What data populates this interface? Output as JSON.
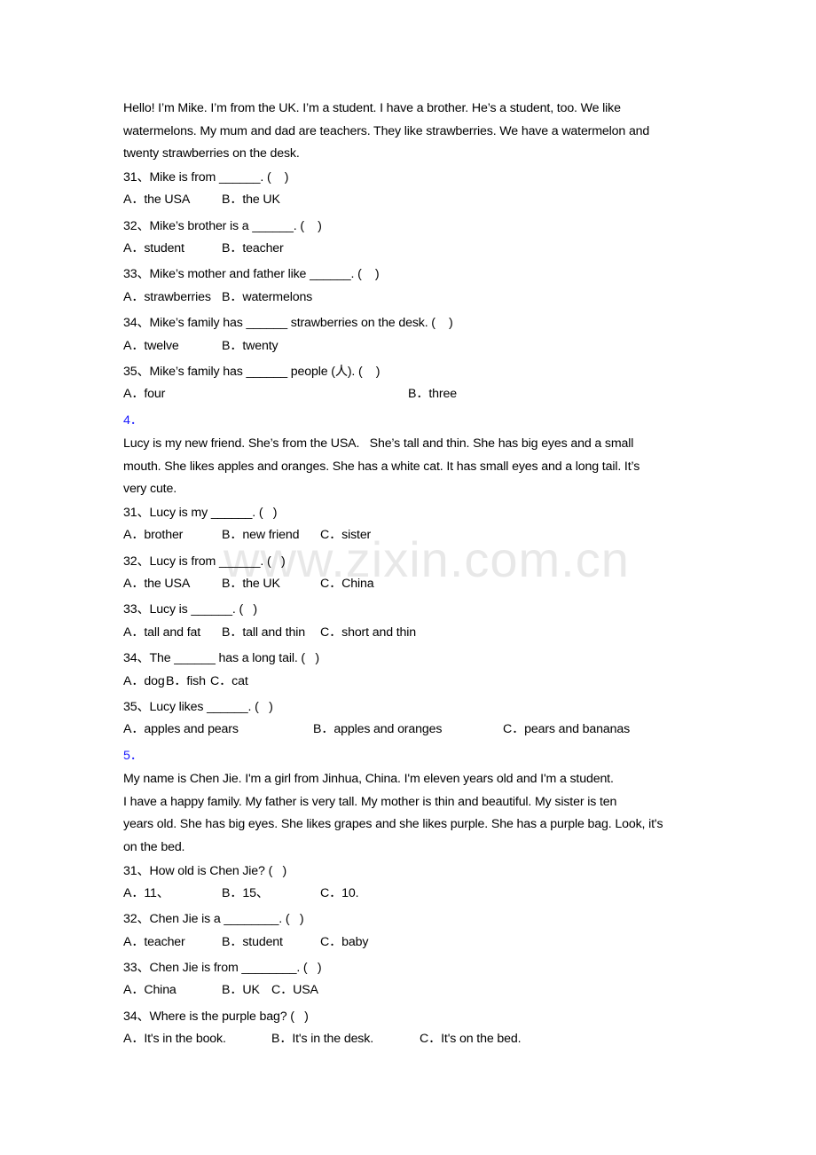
{
  "watermark": "www.zixin.com.cn",
  "sections": [
    {
      "number": "",
      "passage": [
        "Hello! I’m Mike. I’m from the UK. I’m a student. I have a brother. He’s a student, too. We like",
        "watermelons. My mum and dad are teachers. They like strawberries. We have a watermelon and",
        "twenty strawberries on the desk."
      ],
      "questions": [
        {
          "q": "31、Mike is from ______. (    )",
          "options": [
            "A．the USA",
            "B．the UK"
          ]
        },
        {
          "q": "32、Mike’s brother is a ______. (    )",
          "options": [
            "A．student",
            "B．teacher"
          ]
        },
        {
          "q": "33、Mike’s mother and father like ______. (    )",
          "options": [
            "A．strawberries",
            "B．watermelons"
          ]
        },
        {
          "q": "34、Mike’s family has ______ strawberries on the desk. (    )",
          "options": [
            "A．twelve",
            "B．twenty"
          ]
        },
        {
          "q": "35、Mike’s family has ______ people (人). (    )",
          "options": [
            "A．four",
            "B．three"
          ]
        }
      ]
    },
    {
      "number": "4．",
      "passage": [
        "Lucy is my new friend. She’s from the USA.   She’s tall and thin. She has big eyes and a small",
        "mouth. She likes apples and oranges. She has a white cat. It has small eyes and a long tail. It’s",
        "very cute."
      ],
      "questions": [
        {
          "q": "31、Lucy is my ______. (   )",
          "options": [
            "A．brother",
            "B．new friend",
            "C．sister"
          ]
        },
        {
          "q": "32、Lucy is from ______. (   )",
          "options": [
            "A．the USA",
            "B．the UK",
            "C．China"
          ]
        },
        {
          "q": "33、Lucy is ______. (   )",
          "options": [
            "A．tall and fat",
            "B．tall and thin",
            "C．short and thin"
          ]
        },
        {
          "q": "34、The ______ has a long tail. (   )",
          "options": [
            "A．dog",
            "B．fish",
            "C．cat"
          ]
        },
        {
          "q": "35、Lucy likes ______. (   )",
          "options": [
            "A．apples and pears",
            "B．apples and oranges",
            "C．pears and bananas"
          ]
        }
      ]
    },
    {
      "number": "5．",
      "passage": [
        "My name is Chen Jie. I'm a girl from Jinhua, China. I'm eleven years old and I'm a student.",
        "I have a happy family. My father is very tall. My mother is thin and beautiful. My sister is ten",
        "years old. She has big eyes. She likes grapes and she likes purple. She has a purple bag. Look, it's",
        "on the bed."
      ],
      "questions": [
        {
          "q": "31、How old is Chen Jie? (   )",
          "options": [
            "A．11、",
            "B．15、",
            "C．10."
          ]
        },
        {
          "q": "32、Chen Jie is a ________. (   )",
          "options": [
            "A．teacher",
            "B．student",
            "C．baby"
          ]
        },
        {
          "q": "33、Chen Jie is from ________. (   )",
          "options": [
            "A．China",
            "B．UK",
            "C．USA"
          ]
        },
        {
          "q": "34、Where is the purple bag? (   )",
          "options": [
            "A．It's in the book.",
            "B．It's in the desk.",
            "C．It's on the bed."
          ]
        }
      ]
    }
  ]
}
